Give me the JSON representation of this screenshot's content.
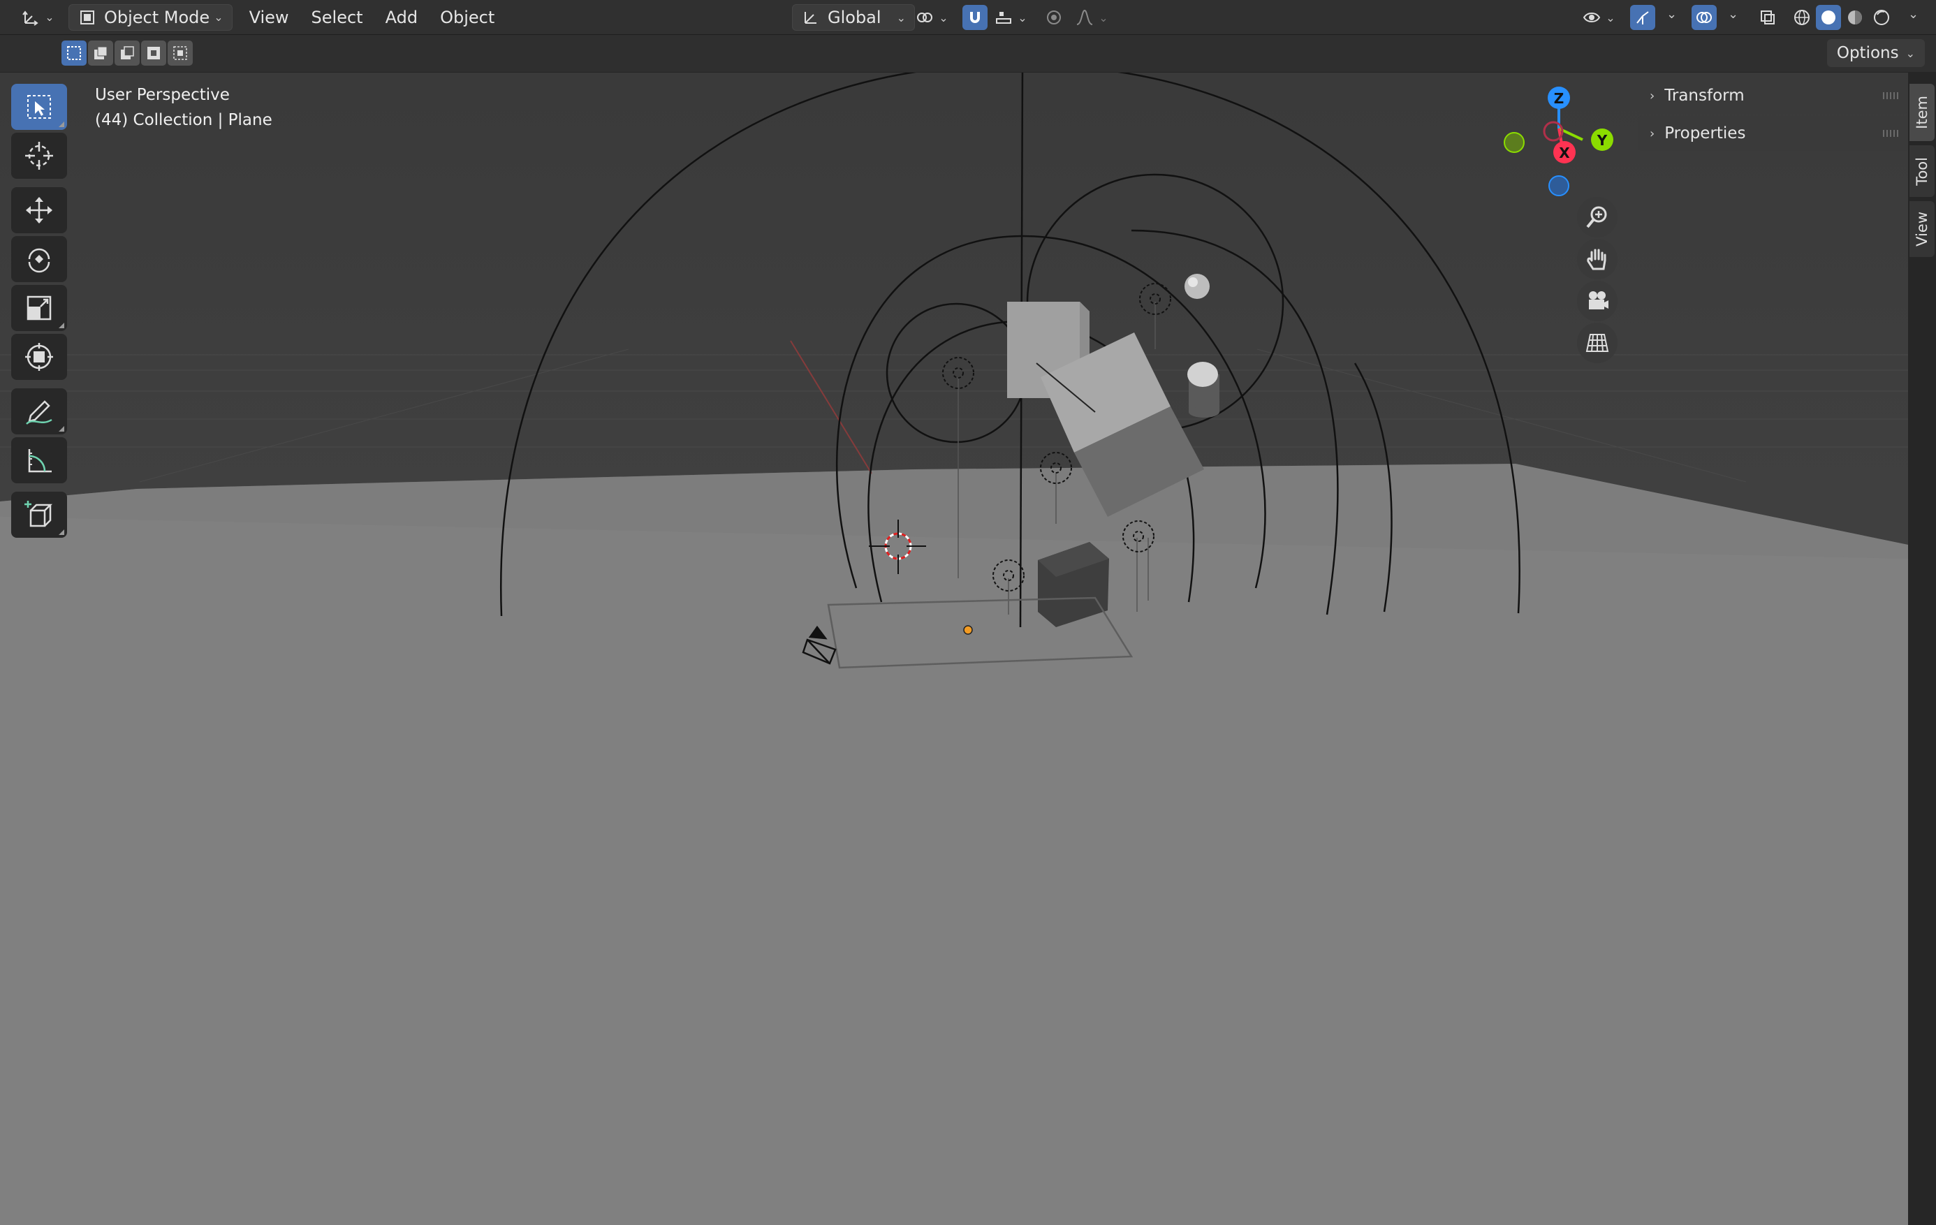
{
  "header": {
    "mode": "Object Mode",
    "menus": [
      "View",
      "Select",
      "Add",
      "Object"
    ],
    "orientation": "Global"
  },
  "toolsettings": {
    "options_label": "Options"
  },
  "viewport": {
    "perspective_label": "User Perspective",
    "collection_label": "(44) Collection | Plane"
  },
  "gizmo": {
    "axis_x": "X",
    "axis_y": "Y",
    "axis_z": "Z",
    "colors": {
      "x": "#ff3352",
      "y": "#8bdc00",
      "z": "#2890ff"
    }
  },
  "npanel": {
    "panels": [
      "Transform",
      "Properties"
    ],
    "tabs": [
      "Item",
      "Tool",
      "View"
    ]
  },
  "icons": {
    "editor_type": "axes-icon",
    "tools": [
      "select-box-icon",
      "cursor-icon",
      "move-icon",
      "rotate-icon",
      "scale-icon",
      "transform-icon",
      "annotate-icon",
      "measure-icon",
      "add-cube-icon"
    ],
    "nav": [
      "zoom-icon",
      "pan-hand-icon",
      "camera-icon",
      "grid-icon"
    ]
  },
  "colors": {
    "accent": "#4772b3",
    "header_bg": "#303030",
    "floor": "#808080",
    "background": "#3d3d3d"
  }
}
